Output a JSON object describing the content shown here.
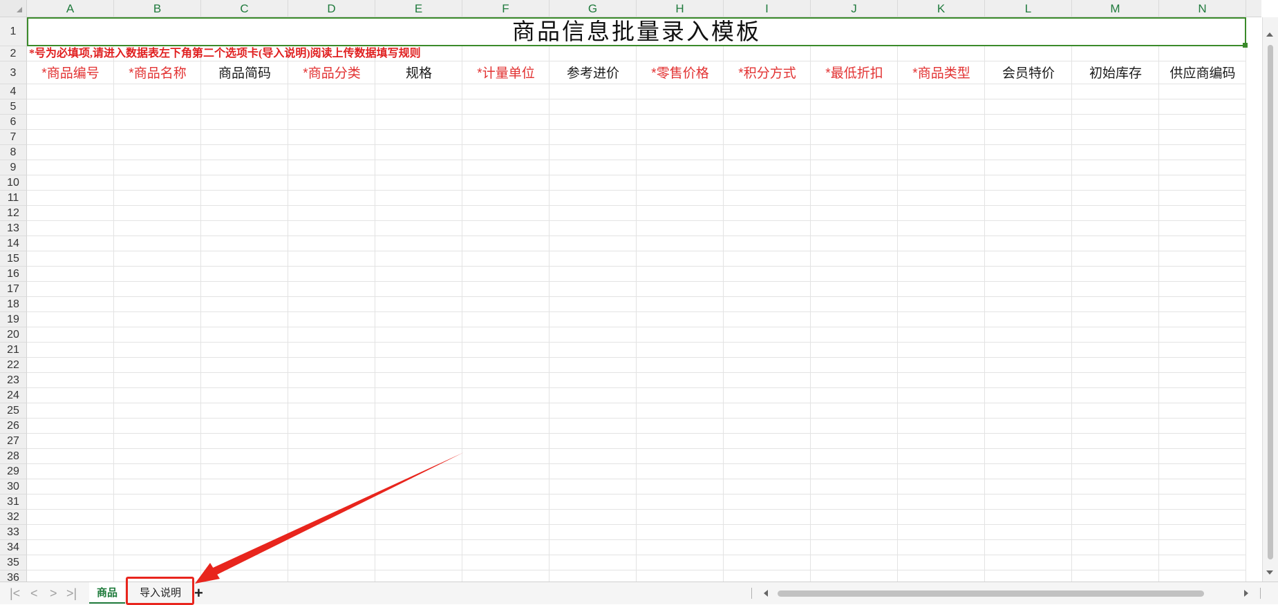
{
  "sheet": {
    "columns": [
      "A",
      "B",
      "C",
      "D",
      "E",
      "F",
      "G",
      "H",
      "I",
      "J",
      "K",
      "L",
      "M",
      "N"
    ],
    "rows": [
      "1",
      "2",
      "3",
      "4",
      "5",
      "6",
      "7",
      "8",
      "9",
      "10",
      "11",
      "12",
      "13",
      "14",
      "15",
      "16",
      "17",
      "18",
      "19",
      "20",
      "21",
      "22",
      "23",
      "24",
      "25",
      "26",
      "27",
      "28",
      "29",
      "30",
      "31",
      "32",
      "33",
      "34",
      "35",
      "36"
    ],
    "title": "商品信息批量录入模板",
    "note": "*号为必填项,请进入数据表左下角第二个选项卡(导入说明)阅读上传数据填写规则",
    "headers": [
      {
        "text": "*商品编号",
        "required": true
      },
      {
        "text": "*商品名称",
        "required": true
      },
      {
        "text": "商品简码",
        "required": false
      },
      {
        "text": "*商品分类",
        "required": true
      },
      {
        "text": "规格",
        "required": false
      },
      {
        "text": "*计量单位",
        "required": true
      },
      {
        "text": "参考进价",
        "required": false
      },
      {
        "text": "*零售价格",
        "required": true
      },
      {
        "text": "*积分方式",
        "required": true
      },
      {
        "text": "*最低折扣",
        "required": true
      },
      {
        "text": "*商品类型",
        "required": true
      },
      {
        "text": "会员特价",
        "required": false
      },
      {
        "text": "初始库存",
        "required": false
      },
      {
        "text": "供应商编码",
        "required": false
      }
    ]
  },
  "tabs": {
    "active": "商品",
    "second": "导入说明",
    "add": "+"
  },
  "nav": {
    "first": "|<",
    "prev": "<",
    "next": ">",
    "last": ">|"
  },
  "colors": {
    "required": "#e23232",
    "accent": "#1d7a3a",
    "annotation": "#e8251d"
  }
}
